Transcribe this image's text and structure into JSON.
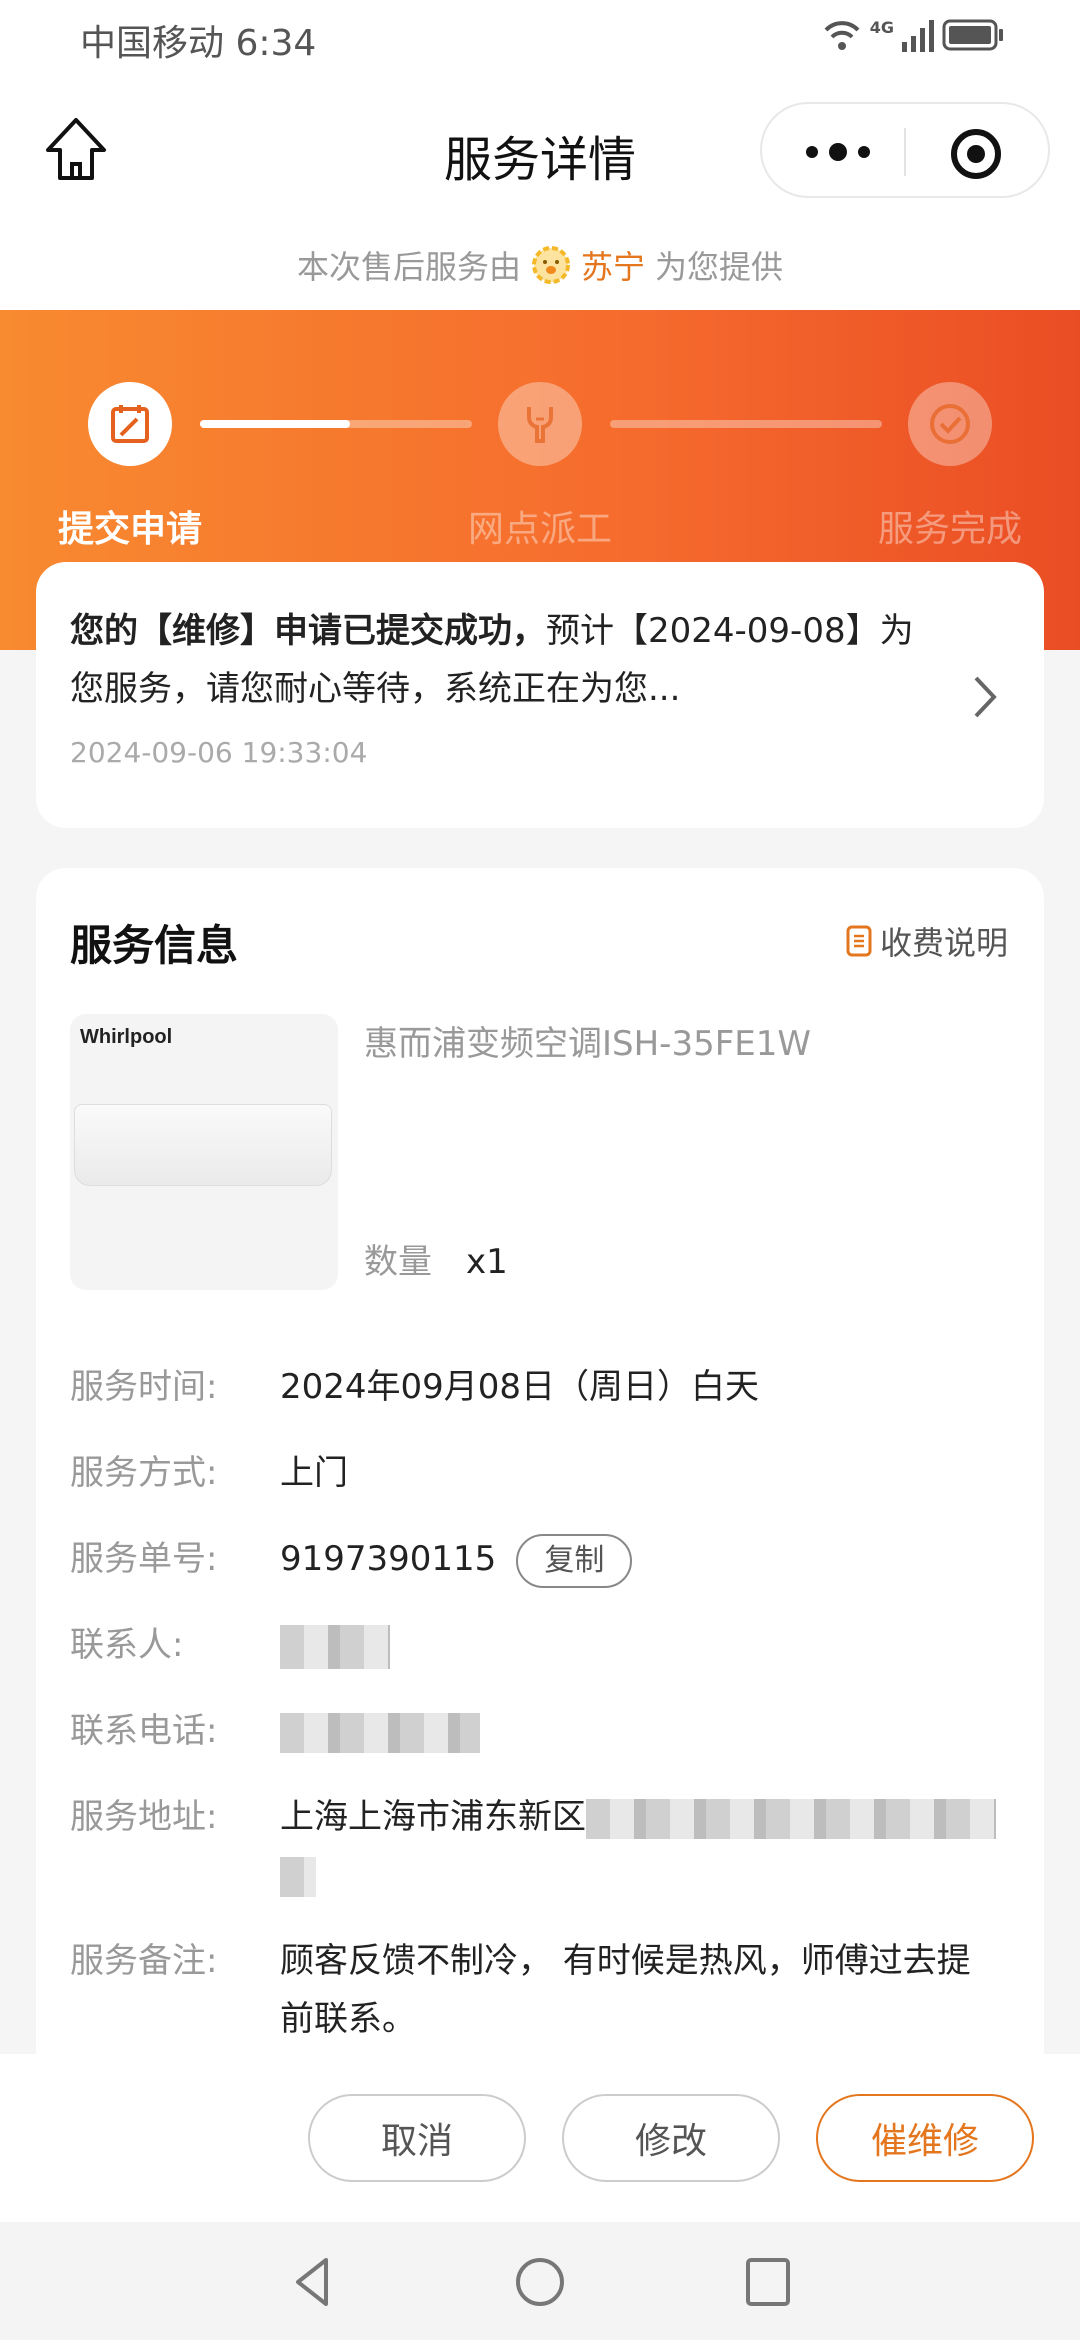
{
  "status_bar": {
    "carrier_time": "中国移动 6:34",
    "network": "4G",
    "icons": [
      "wifi-icon",
      "signal-icon",
      "battery-icon"
    ]
  },
  "nav": {
    "title": "服务详情",
    "home_icon": "home-icon",
    "more_icon": "more-icon",
    "close_icon": "target-icon"
  },
  "provider": {
    "prefix": "本次售后服务由",
    "brand": "苏宁",
    "suffix": "为您提供",
    "brand_color": "#e4761e"
  },
  "progress": {
    "steps": [
      {
        "label": "提交申请",
        "icon": "calendar-edit-icon",
        "state": "active"
      },
      {
        "label": "网点派工",
        "icon": "wrench-icon",
        "state": "inactive"
      },
      {
        "label": "服务完成",
        "icon": "check-circle-icon",
        "state": "inactive"
      }
    ],
    "segment1_fill": 0.55,
    "segment2_fill": 0
  },
  "notice": {
    "bold_text": "您的【维修】申请已提交成功，",
    "text": "预计【2024-09-08】为您服务，请您耐心等待，系统正在为您...",
    "timestamp": "2024-09-06 19:33:04"
  },
  "service_info": {
    "title": "服务信息",
    "fee_link": "收费说明",
    "product": {
      "brand_logo": "Whirlpool",
      "name": "惠而浦变频空调ISH-35FE1W",
      "qty_label": "数量",
      "qty_value": "x1"
    },
    "rows": [
      {
        "label": "服务时间:",
        "value": "2024年09月08日（周日）白天"
      },
      {
        "label": "服务方式:",
        "value": "上门"
      },
      {
        "label": "服务单号:",
        "value": "9197390115",
        "action": "复制"
      },
      {
        "label": "联系人:",
        "value": ""
      },
      {
        "label": "联系电话:",
        "value": "138*****739"
      },
      {
        "label": "服务地址:",
        "value": "上海上海市浦东新区"
      },
      {
        "label": "服务备注:",
        "value": "顾客反馈不制冷， 有时候是热风，师傅过去提前联系。"
      }
    ]
  },
  "actions": {
    "cancel": "取消",
    "modify": "修改",
    "urge": "催维修"
  }
}
